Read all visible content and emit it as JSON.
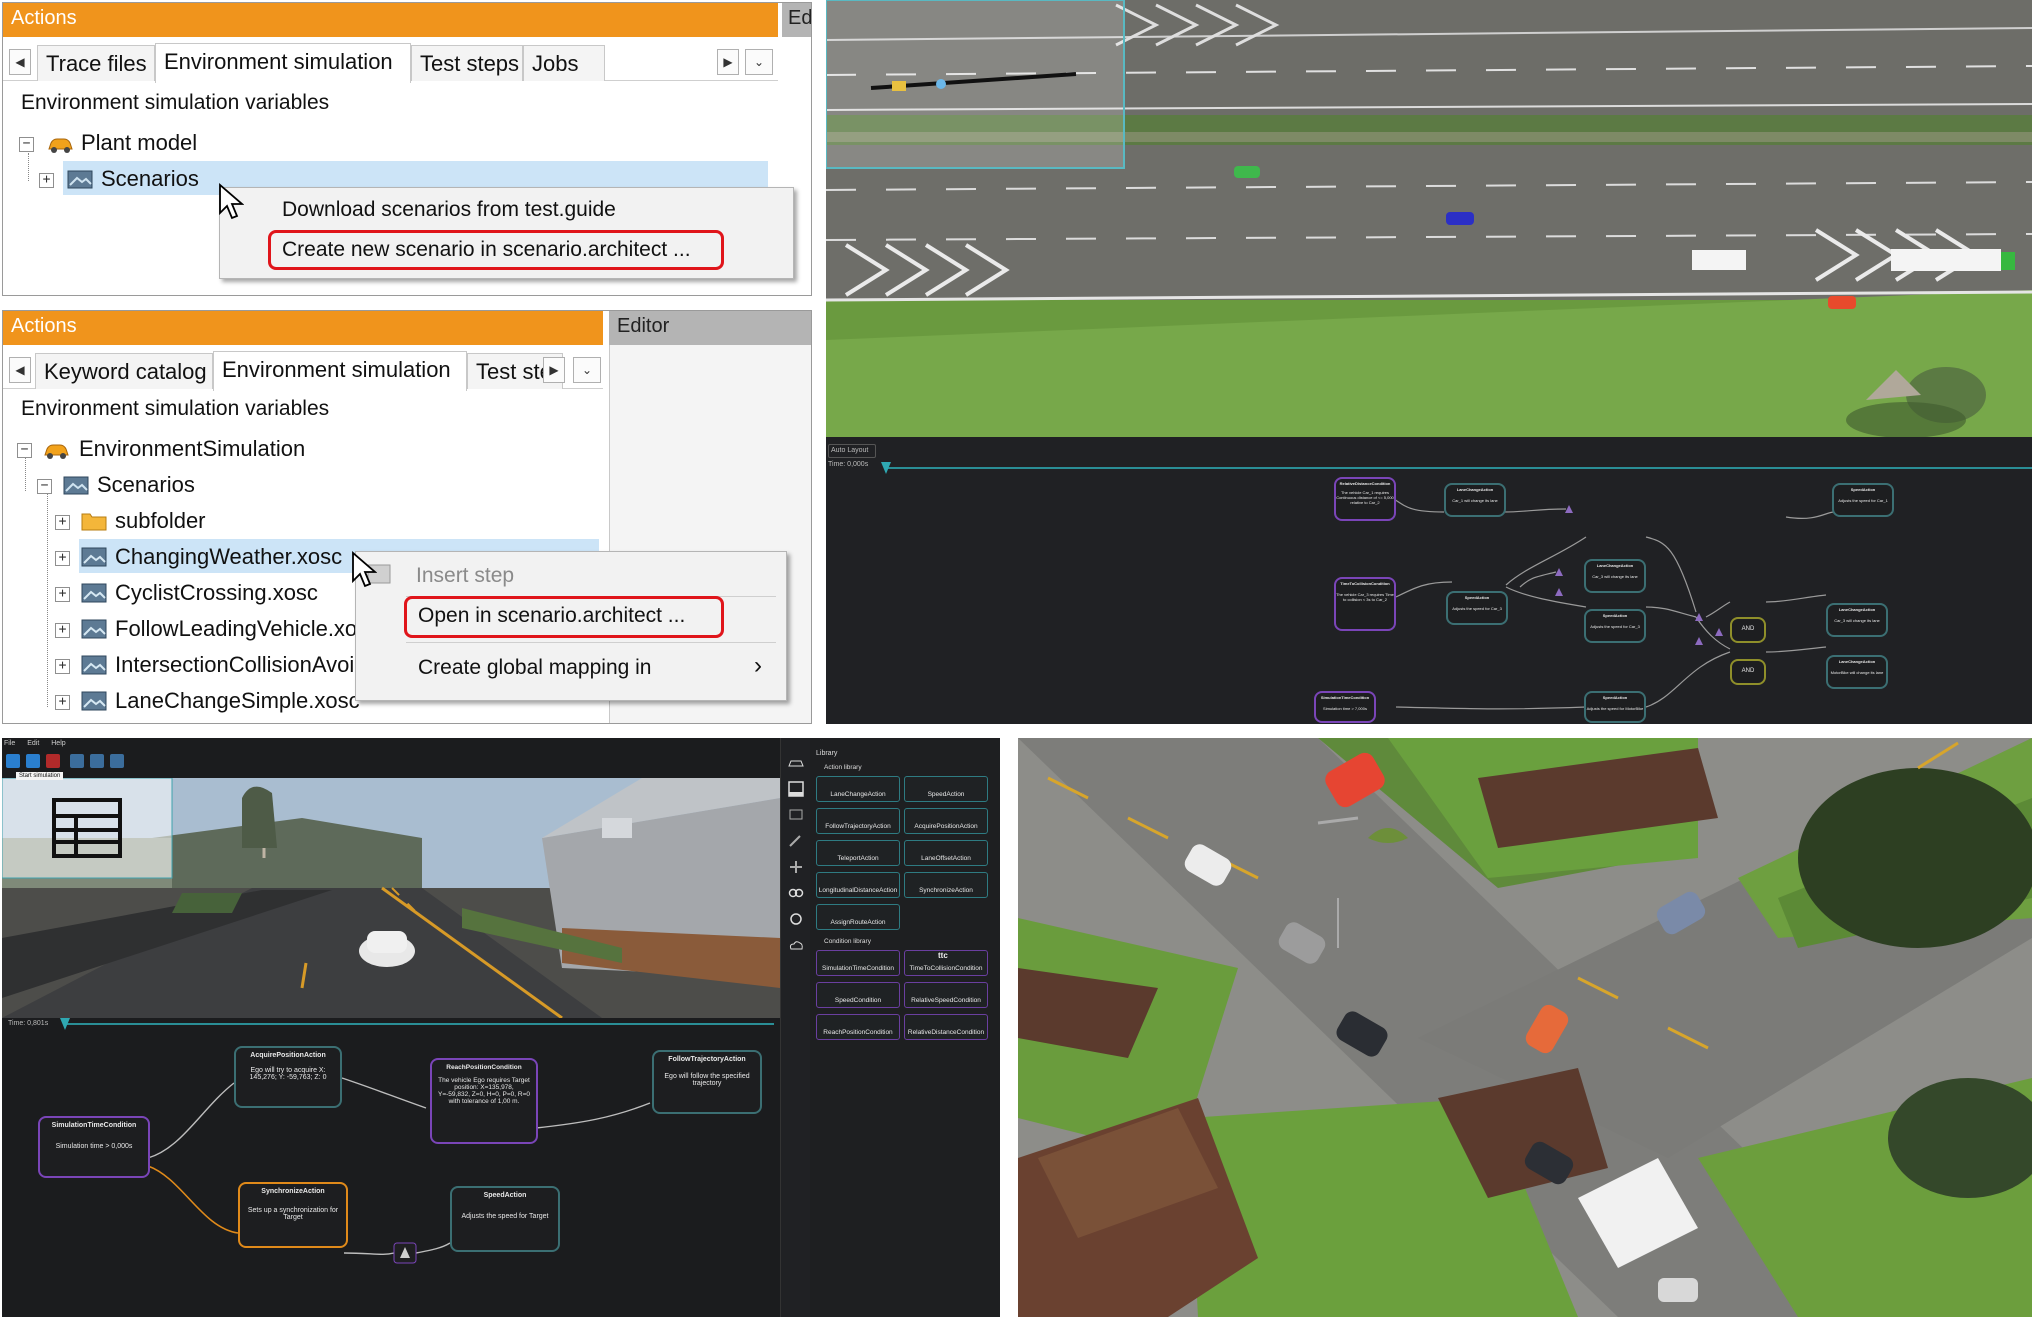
{
  "panel1": {
    "title": "Actions",
    "side_tab": "Ed",
    "tabs": [
      "Trace files",
      "Environment simulation",
      "Test steps",
      "Jobs"
    ],
    "active_tab": 1,
    "tree_header": "Environment simulation variables",
    "tree": [
      {
        "label": "Plant model",
        "icon": "car-icon",
        "expander": "−"
      },
      {
        "label": "Scenarios",
        "icon": "scenario-icon",
        "expander": "+",
        "selected": true
      }
    ],
    "context_menu": [
      "Download scenarios from test.guide",
      "Create new scenario in scenario.architect ..."
    ],
    "highlighted_item": 1
  },
  "panel2": {
    "title": "Actions",
    "editor_label": "Editor",
    "tabs": [
      "Keyword catalog",
      "Environment simulation",
      "Test ste"
    ],
    "active_tab": 1,
    "tree_header": "Environment simulation variables",
    "tree": [
      {
        "label": "EnvironmentSimulation",
        "icon": "car-icon",
        "expander": "−",
        "level": 0
      },
      {
        "label": "Scenarios",
        "icon": "scenario-icon",
        "expander": "−",
        "level": 1
      },
      {
        "label": "subfolder",
        "icon": "folder-icon",
        "expander": "+",
        "level": 2
      },
      {
        "label": "ChangingWeather.xosc",
        "icon": "image-icon",
        "expander": "+",
        "level": 2,
        "selected": true
      },
      {
        "label": "CyclistCrossing.xosc",
        "icon": "image-icon",
        "expander": "+",
        "level": 2
      },
      {
        "label": "FollowLeadingVehicle.xo",
        "icon": "image-icon",
        "expander": "+",
        "level": 2
      },
      {
        "label": "IntersectionCollisionAvoi",
        "icon": "image-icon",
        "expander": "+",
        "level": 2
      },
      {
        "label": "LaneChangeSimple.xosc",
        "icon": "image-icon",
        "expander": "+",
        "level": 2
      }
    ],
    "context_menu": [
      {
        "label": "Insert step",
        "disabled": true
      },
      {
        "label": "Open in scenario.architect ...",
        "disabled": false
      },
      {
        "label": "Create global mapping in",
        "disabled": false,
        "submenu": "›"
      }
    ]
  },
  "panel3": {
    "toolbar_button": "Auto Layout",
    "time_label": "Time: 0,000s",
    "nodes": [
      {
        "title": "RelativeDistanceCondition",
        "body": "The vehicle Car_1 requires Continuous distance of <= 5,000 relative to Car_2"
      },
      {
        "title": "LaneChangeAction",
        "body": "Car_1 will change its lane"
      },
      {
        "title": "SpeedAction",
        "body": "Adjusts the speed for Car_1"
      },
      {
        "title": "TimeToCollisionCondition",
        "body": "The vehicle Car_3 requires Time to collision < 3s to Car_2"
      },
      {
        "title": "SpeedAction",
        "body": "Adjusts the speed for Car_3"
      },
      {
        "title": "LaneChangeAction",
        "body": "Car_3 will change its lane"
      },
      {
        "title": "SpeedAction",
        "body": "Adjusts the speed for Car_3"
      },
      {
        "title": "AND",
        "body": ""
      },
      {
        "title": "LaneChangeAction",
        "body": "Car_3 will change its lane"
      },
      {
        "title": "SimulationTimeCondition",
        "body": "Simulation time > 7,000s"
      },
      {
        "title": "SpeedAction",
        "body": "Adjusts the speed for MotorBike"
      },
      {
        "title": "AND",
        "body": ""
      },
      {
        "title": "LaneChangeAction",
        "body": "MotorBike will change its lane"
      }
    ]
  },
  "panel4": {
    "menu": [
      "File",
      "Edit",
      "Help"
    ],
    "tooltip": "Start simulation",
    "time_label": "Time: 0,801s",
    "nodes": {
      "simulation_time": {
        "title": "SimulationTimeCondition",
        "body": "Simulation time > 0,000s"
      },
      "acquire_position": {
        "title": "AcquirePositionAction",
        "body": "Ego will try to acquire X: 145,276; Y: -59,763; Z: 0"
      },
      "reach_position": {
        "title": "ReachPositionCondition",
        "body": "The vehicle Ego requires Target position: X=135,978, Y=-59,832, Z=0, H=0, P=0, R=0 with tolerance of 1,00 m."
      },
      "follow_trajectory": {
        "title": "FollowTrajectoryAction",
        "body": "Ego will follow the specified trajectory"
      },
      "synchronize": {
        "title": "SynchronizeAction",
        "body": "Sets up a synchronization for Target"
      },
      "speed": {
        "title": "SpeedAction",
        "body": "Adjusts the speed for Target"
      }
    },
    "library": {
      "title": "Library",
      "action_section": "Action library",
      "actions": [
        "LaneChangeAction",
        "SpeedAction",
        "FollowTrajectoryAction",
        "AcquirePositionAction",
        "TeleportAction",
        "LaneOffsetAction",
        "LongitudinalDistanceAction",
        "SynchronizeAction",
        "AssignRouteAction"
      ],
      "condition_section": "Condition library",
      "conditions": [
        "SimulationTimeCondition",
        "TimeToCollisionCondition",
        "SpeedCondition",
        "RelativeSpeedCondition",
        "ReachPositionCondition",
        "RelativeDistanceCondition"
      ],
      "ttc_label": "ttc"
    }
  },
  "colors": {
    "title_orange": "#f0941c",
    "highlight_red": "#e0151b",
    "selection_blue": "#cce4f7",
    "node_teal": "#3b6f73",
    "node_purple": "#7a45b8",
    "node_orange": "#e08a1a"
  }
}
